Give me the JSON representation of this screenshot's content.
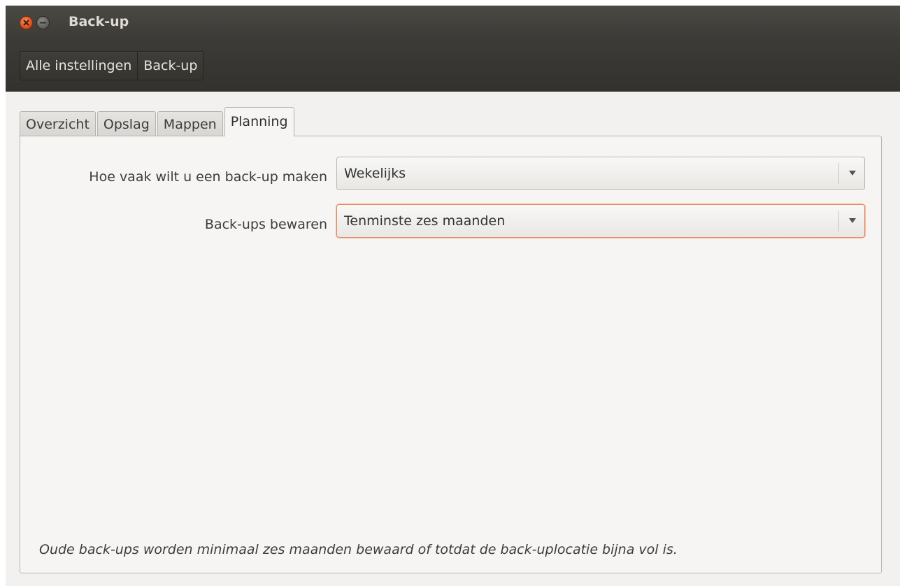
{
  "window": {
    "title": "Back-up"
  },
  "breadcrumb": {
    "items": [
      {
        "label": "Alle instellingen"
      },
      {
        "label": "Back-up"
      }
    ]
  },
  "tabs": [
    {
      "label": "Overzicht",
      "active": false
    },
    {
      "label": "Opslag",
      "active": false
    },
    {
      "label": "Mappen",
      "active": false
    },
    {
      "label": "Planning",
      "active": true
    }
  ],
  "schedule": {
    "frequency_label": "Hoe vaak wilt u een back-up maken",
    "frequency_value": "Wekelijks",
    "keep_label": "Back-ups bewaren",
    "keep_value": "Tenminste zes maanden",
    "note": "Oude back-ups worden minimaal zes maanden bewaard of totdat de back-uplocatie bijna vol is."
  },
  "colors": {
    "titlebar": "#3c3b37",
    "close_button": "#df4a16",
    "focus_ring": "#e18c66"
  }
}
